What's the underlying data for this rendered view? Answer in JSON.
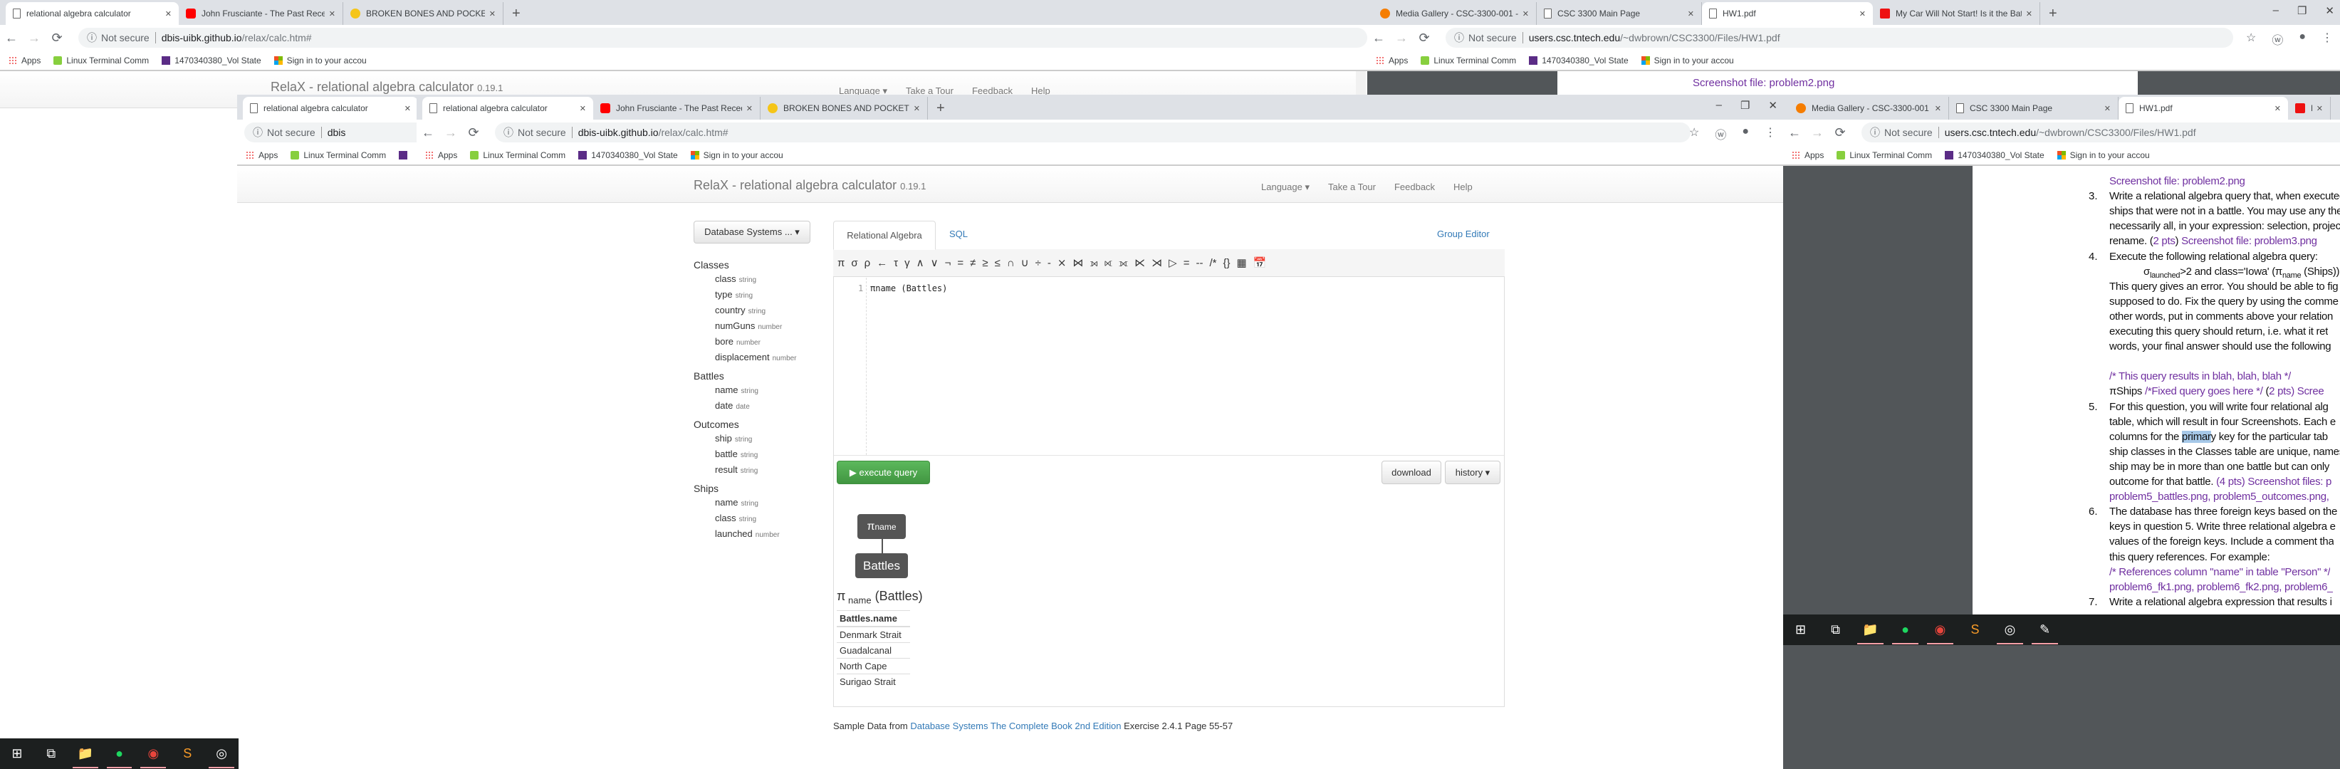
{
  "windows": {
    "a": {
      "tabs": [
        {
          "title": "relational algebra calculator",
          "icon": "page-icon",
          "active": true
        },
        {
          "title": "John Frusciante - The Past Recedes",
          "icon": "youtube-icon"
        },
        {
          "title": "BROKEN BONES AND POCKET CHANGE",
          "icon": "grammarly-icon"
        }
      ],
      "not_secure": "Not secure",
      "url_host": "dbis-uibk.github.io",
      "url_path": "/relax/calc.htm#",
      "bookmarks": [
        {
          "label": "Apps",
          "icon": "apps-icon"
        },
        {
          "label": "Linux Terminal Comm",
          "icon": "mint-icon"
        },
        {
          "label": "1470340380_Vol State",
          "icon": "w-icon"
        },
        {
          "label": "Sign in to your accou",
          "icon": "ms-icon"
        }
      ],
      "page": {
        "title": "RelaX - relational algebra calculator",
        "version": "0.19.1",
        "nav": [
          "Language ▾",
          "Take a Tour",
          "Feedback",
          "Help"
        ]
      }
    },
    "b1": {
      "tabs": [
        {
          "title": "relational algebra calculator",
          "icon": "page-icon",
          "active": true
        }
      ],
      "not_secure": "Not secure",
      "url_host": "dbis",
      "url_path": "",
      "bookmarks": [
        {
          "label": "Apps",
          "icon": "apps-icon"
        },
        {
          "label": "Linux Terminal Comm",
          "icon": "mint-icon"
        },
        {
          "label": "",
          "icon": "w-icon"
        }
      ]
    },
    "b2": {
      "tabs": [
        {
          "title": "relational algebra calculator",
          "icon": "page-icon",
          "active": true
        },
        {
          "title": "John Frusciante - The Past Recedes",
          "icon": "youtube-icon"
        },
        {
          "title": "BROKEN BONES AND POCKET CHANGE",
          "icon": "grammarly-icon"
        }
      ],
      "not_secure": "Not secure",
      "url_host": "dbis-uibk.github.io",
      "url_path": "/relax/calc.htm#",
      "bookmarks": [
        {
          "label": "Apps",
          "icon": "apps-icon"
        },
        {
          "label": "Linux Terminal Comm",
          "icon": "mint-icon"
        },
        {
          "label": "1470340380_Vol State",
          "icon": "w-icon"
        },
        {
          "label": "Sign in to your accou",
          "icon": "ms-icon"
        }
      ]
    },
    "c": {
      "tabs": [
        {
          "title": "Media Gallery - CSC-3300-001 - Database",
          "icon": "blogger-icon"
        },
        {
          "title": "CSC 3300 Main Page",
          "icon": "page-icon"
        },
        {
          "title": "HW1.pdf",
          "icon": "page-icon",
          "active": true
        },
        {
          "title": "My Car Will Not Start! Is it the Battery",
          "icon": "redcross-icon"
        }
      ],
      "not_secure": "Not secure",
      "url_host": "users.csc.tntech.edu",
      "url_path": "/~dwbrown/CSC3300/Files/HW1.pdf",
      "bookmarks": [
        {
          "label": "Apps",
          "icon": "apps-icon"
        },
        {
          "label": "Linux Terminal Comm",
          "icon": "mint-icon"
        },
        {
          "label": "1470340380_Vol State",
          "icon": "w-icon"
        },
        {
          "label": "Sign in to your accou",
          "icon": "ms-icon"
        }
      ],
      "pdf_text": "Screenshot file: problem2.png"
    },
    "d": {
      "tabs": [
        {
          "title": "Media Gallery - CSC-3300-001 - Database",
          "icon": "blogger-icon"
        },
        {
          "title": "CSC 3300 Main Page",
          "icon": "page-icon"
        },
        {
          "title": "HW1.pdf",
          "icon": "page-icon",
          "active": true
        },
        {
          "title": "My Car Will Not Start!",
          "icon": "redcross-icon"
        }
      ],
      "not_secure": "Not secure",
      "url_host": "users.csc.tntech.edu",
      "url_path": "/~dwbrown/CSC3300/Files/HW1.pdf",
      "bookmarks": [
        {
          "label": "Apps",
          "icon": "apps-icon"
        },
        {
          "label": "Linux Terminal Comm",
          "icon": "mint-icon"
        },
        {
          "label": "1470340380_Vol State",
          "icon": "w-icon"
        },
        {
          "label": "Sign in to your accou",
          "icon": "ms-icon"
        }
      ]
    }
  },
  "relax": {
    "title": "RelaX - relational algebra calculator",
    "version": "0.19.1",
    "nav": [
      "Language ▾",
      "Take a Tour",
      "Feedback",
      "Help"
    ],
    "dataset_button": "Database Systems ... ▾",
    "tabs": [
      "Relational Algebra",
      "SQL"
    ],
    "group_editor": "Group Editor",
    "toolbar": [
      "π",
      "σ",
      "ρ",
      "←",
      "τ",
      "γ",
      "∧",
      "∨",
      "¬",
      "=",
      "≠",
      "≥",
      "≤",
      "∩",
      "∪",
      "÷",
      "-",
      "⨯",
      "⋈",
      "⟕",
      "⟖",
      "⟗",
      "⋉",
      "⋊",
      "▷",
      "=",
      "--",
      "/*",
      "{}"
    ],
    "line_number": "1",
    "query": "πname (Battles)",
    "execute": "execute query",
    "download": "download",
    "history": "history ▾",
    "schema": [
      {
        "name": "Classes",
        "cols": [
          [
            "class",
            "string"
          ],
          [
            "type",
            "string"
          ],
          [
            "country",
            "string"
          ],
          [
            "numGuns",
            "number"
          ],
          [
            "bore",
            "number"
          ],
          [
            "displacement",
            "number"
          ]
        ]
      },
      {
        "name": "Battles",
        "cols": [
          [
            "name",
            "string"
          ],
          [
            "date",
            "date"
          ]
        ]
      },
      {
        "name": "Outcomes",
        "cols": [
          [
            "ship",
            "string"
          ],
          [
            "battle",
            "string"
          ],
          [
            "result",
            "string"
          ]
        ]
      },
      {
        "name": "Ships",
        "cols": [
          [
            "name",
            "string"
          ],
          [
            "class",
            "string"
          ],
          [
            "launched",
            "number"
          ]
        ]
      }
    ],
    "tree": {
      "op": "π",
      "op_sub": "name",
      "leaf": "Battles"
    },
    "result_expr": {
      "op": "π",
      "sub": "name",
      "arg": "(Battles)"
    },
    "result": {
      "header": "Battles.name",
      "rows": [
        "Denmark Strait",
        "Guadalcanal",
        "North Cape",
        "Surigao Strait"
      ]
    },
    "footer": {
      "prefix": "Sample Data from",
      "link": "Database Systems The Complete Book 2nd Edition",
      "suffix": "Exercise 2.4.1 Page 55-57"
    }
  },
  "pdf": {
    "purple": "#7030a0",
    "lines": [
      {
        "num": "",
        "segs": [
          {
            "t": "Screenshot file: problem2.png",
            "c": "#7030a0"
          }
        ]
      },
      {
        "num": "3.",
        "segs": [
          {
            "t": "Write a relational algebra query that, when executed,"
          }
        ]
      },
      {
        "num": "",
        "segs": [
          {
            "t": "ships that were not in a battle. You may use any the"
          }
        ]
      },
      {
        "num": "",
        "segs": [
          {
            "t": "necessarily all, in your expression: selection, projection,"
          }
        ]
      },
      {
        "num": "",
        "segs": [
          {
            "t": "rename. ("
          },
          {
            "t": "2 pts",
            "c": "#7030a0"
          },
          {
            "t": ") "
          },
          {
            "t": "Screenshot file: problem3.png",
            "c": "#7030a0"
          }
        ]
      },
      {
        "num": "4.",
        "segs": [
          {
            "t": "Execute the following relational algebra query:"
          }
        ]
      },
      {
        "num": "",
        "indent": true,
        "segs": [
          {
            "t": "σ"
          },
          {
            "t": "launched",
            "sub": true
          },
          {
            "t": ">2 and class='Iowa' (π"
          },
          {
            "t": "name",
            "sub": true
          },
          {
            "t": " (Ships))"
          }
        ]
      },
      {
        "num": "",
        "segs": [
          {
            "t": "This query gives an error. You should be able to fig"
          }
        ]
      },
      {
        "num": "",
        "segs": [
          {
            "t": "supposed to do. Fix the query by using the comme"
          }
        ]
      },
      {
        "num": "",
        "segs": [
          {
            "t": "other words, put in comments above your relation"
          }
        ]
      },
      {
        "num": "",
        "segs": [
          {
            "t": "executing this query should return, i.e. what it ret"
          }
        ]
      },
      {
        "num": "",
        "segs": [
          {
            "t": "words, your final answer should use the following"
          }
        ]
      },
      {
        "num": "",
        "segs": []
      },
      {
        "num": "",
        "segs": [
          {
            "t": "/* This query results in blah, blah, blah */",
            "c": "#7030a0"
          }
        ]
      },
      {
        "num": "",
        "segs": [
          {
            "t": "πShips      "
          },
          {
            "t": "/*Fixed query goes here */",
            "c": "#7030a0"
          },
          {
            "t": " ("
          },
          {
            "t": "2 pts) Scree",
            "c": "#7030a0"
          }
        ]
      },
      {
        "num": "5.",
        "segs": [
          {
            "t": "For this question, you will write four relational alg"
          }
        ]
      },
      {
        "num": "",
        "segs": [
          {
            "t": "table, which will result in four Screenshots. Each e"
          }
        ]
      },
      {
        "num": "",
        "segs": [
          {
            "t": "columns for the "
          },
          {
            "t": "primar",
            "hl": true
          },
          {
            "t": "y key for the particular tab"
          }
        ]
      },
      {
        "num": "",
        "segs": [
          {
            "t": "ship classes in the Classes table are unique, names"
          }
        ]
      },
      {
        "num": "",
        "segs": [
          {
            "t": "ship may be in more than one battle but can only"
          }
        ]
      },
      {
        "num": "",
        "segs": [
          {
            "t": "outcome for that battle. "
          },
          {
            "t": "(4 pts) Screenshot files: p",
            "c": "#7030a0"
          }
        ]
      },
      {
        "num": "",
        "segs": [
          {
            "t": "problem5_battles.png, problem5_outcomes.png,",
            "c": "#7030a0"
          }
        ]
      },
      {
        "num": "6.",
        "segs": [
          {
            "t": "The database has three foreign keys based on the"
          }
        ]
      },
      {
        "num": "",
        "segs": [
          {
            "t": "keys in question 5. Write three relational algebra e"
          }
        ]
      },
      {
        "num": "",
        "segs": [
          {
            "t": "values of the foreign keys. Include a comment tha"
          }
        ]
      },
      {
        "num": "",
        "segs": [
          {
            "t": "this query references. For example:"
          }
        ]
      },
      {
        "num": "",
        "segs": [
          {
            "t": "/* References column \"name\" in table \"Person\" */",
            "c": "#7030a0"
          }
        ]
      },
      {
        "num": "",
        "segs": [
          {
            "t": "problem6_fk1.png, problem6_fk2.png, problem6_",
            "c": "#7030a0"
          }
        ]
      },
      {
        "num": "7.",
        "segs": [
          {
            "t": "Write a relational algebra expression that results i"
          }
        ]
      }
    ]
  },
  "taskbar": {
    "items": [
      {
        "name": "windows-start-icon",
        "glyph": "⊞",
        "run": false
      },
      {
        "name": "task-view-icon",
        "glyph": "⧉",
        "run": false
      },
      {
        "name": "file-explorer-icon",
        "glyph": "📁",
        "run": true
      },
      {
        "name": "spotify-icon",
        "glyph": "●",
        "run": true
      },
      {
        "name": "chrome-icon",
        "glyph": "◉",
        "run": true
      },
      {
        "name": "sublime-text-icon",
        "glyph": "S",
        "run": false
      },
      {
        "name": "speaker-app-icon",
        "glyph": "◎",
        "run": true
      },
      {
        "name": "paint-icon",
        "glyph": "✎",
        "run": true
      }
    ]
  }
}
